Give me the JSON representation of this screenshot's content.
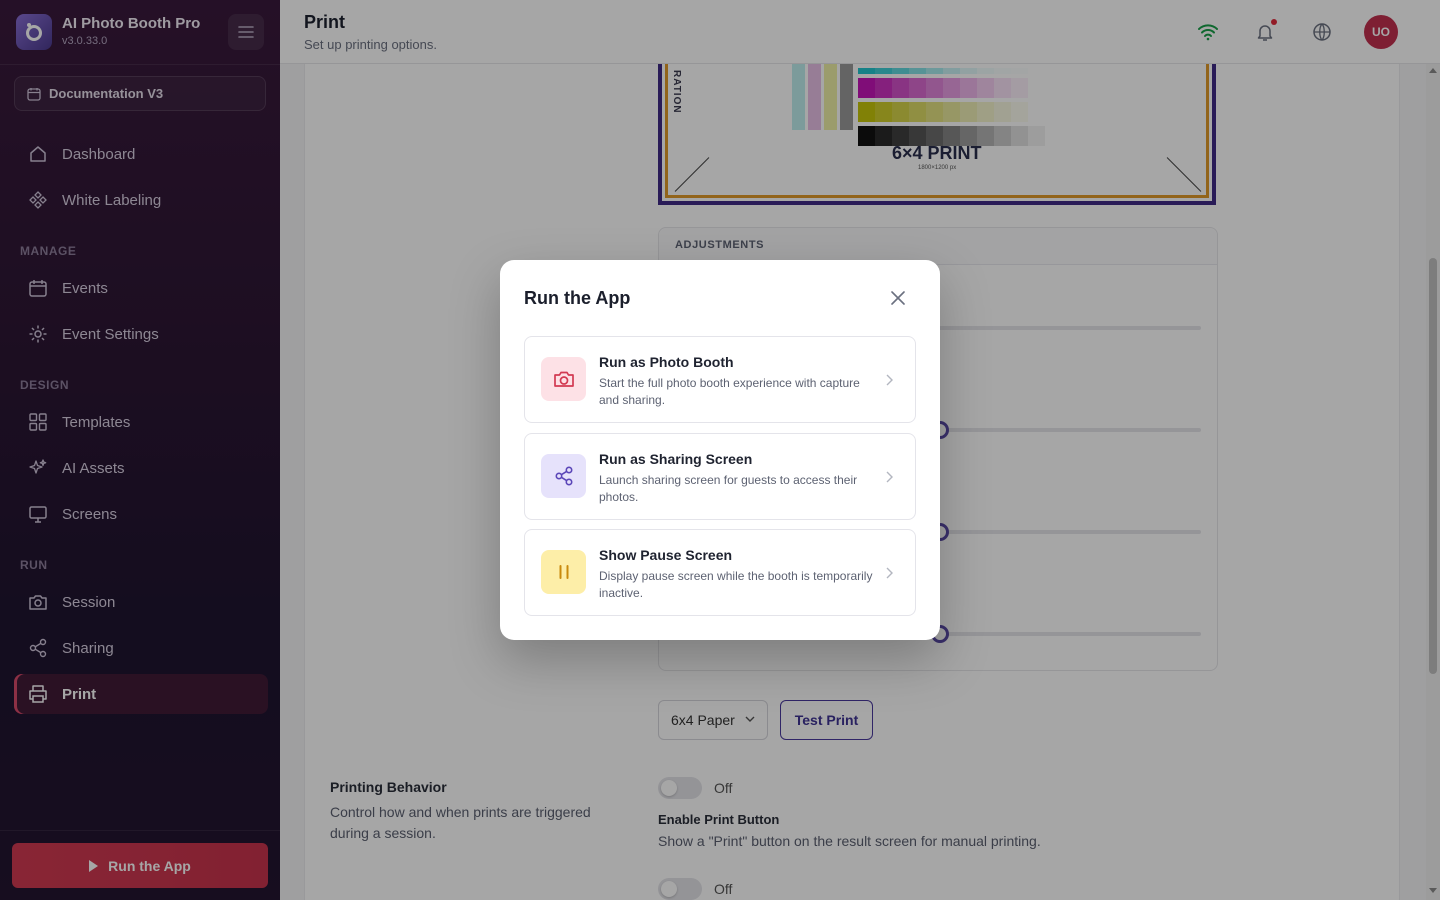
{
  "app": {
    "name": "AI Photo Booth Pro",
    "version": "v3.0.33.0"
  },
  "project": {
    "name": "Documentation V3"
  },
  "sidebar": {
    "top_items": [
      {
        "label": "Dashboard",
        "icon": "home-icon"
      },
      {
        "label": "White Labeling",
        "icon": "palette-icon"
      }
    ],
    "sections": [
      {
        "title": "MANAGE",
        "items": [
          {
            "label": "Events",
            "icon": "calendar-icon"
          },
          {
            "label": "Event Settings",
            "icon": "gear-icon"
          }
        ]
      },
      {
        "title": "DESIGN",
        "items": [
          {
            "label": "Templates",
            "icon": "grid-icon"
          },
          {
            "label": "AI Assets",
            "icon": "sparkles-icon"
          },
          {
            "label": "Screens",
            "icon": "monitor-icon"
          }
        ]
      },
      {
        "title": "RUN",
        "items": [
          {
            "label": "Session",
            "icon": "camera-icon"
          },
          {
            "label": "Sharing",
            "icon": "share-icon"
          },
          {
            "label": "Print",
            "icon": "printer-icon",
            "active": true
          }
        ]
      }
    ],
    "run_button": "Run the App"
  },
  "header": {
    "title": "Print",
    "subtitle": "Set up printing options.",
    "avatar": "UO"
  },
  "main": {
    "preview": {
      "side_label": "RATION",
      "title": "6×4 PRINT",
      "size": "1800×1200 px"
    },
    "adjustments": {
      "heading": "ADJUSTMENTS"
    },
    "paper": {
      "selected": "6x4 Paper"
    },
    "test_print": "Test Print",
    "printing_behavior": {
      "title": "Printing Behavior",
      "description": "Control how and when prints are triggered during a session."
    },
    "options": [
      {
        "state": "Off",
        "title": "Enable Print Button",
        "description": "Show a \"Print\" button on the result screen for manual printing."
      },
      {
        "state": "Off"
      }
    ]
  },
  "modal": {
    "title": "Run the App",
    "options": [
      {
        "title": "Run as Photo Booth",
        "description": "Start the full photo booth experience with capture and sharing.",
        "icon": "camera-icon",
        "color": "#fde1e6"
      },
      {
        "title": "Run as Sharing Screen",
        "description": "Launch sharing screen for guests to access their photos.",
        "icon": "share-icon",
        "color": "#e6e2fb"
      },
      {
        "title": "Show Pause Screen",
        "description": "Display pause screen while the booth is temporarily inactive.",
        "icon": "pause-icon",
        "color": "#fdeea8"
      }
    ]
  },
  "colors": {
    "accent": "#c8334d",
    "brand_purple": "#4b3a9e",
    "wifi": "#18a049"
  }
}
